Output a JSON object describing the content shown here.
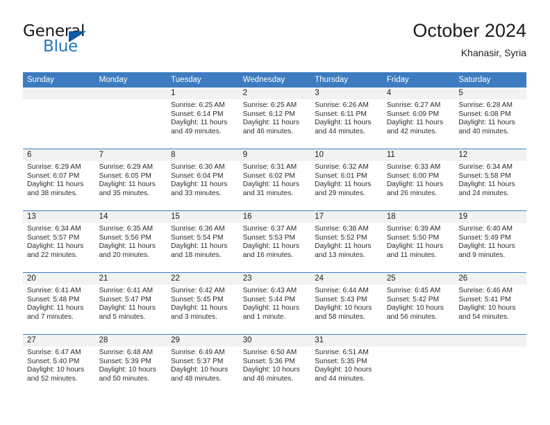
{
  "logo": {
    "word1": "General",
    "word2": "Blue",
    "triangle_color": "#0a5aa8",
    "blue_color": "#2176bd"
  },
  "header": {
    "title": "October 2024",
    "subtitle": "Khanasir, Syria"
  },
  "theme": {
    "header_blue": "#3d7cc0",
    "daynum_bg": "#f2f2f2",
    "text": "#2b2b2b"
  },
  "weekdays": [
    "Sunday",
    "Monday",
    "Tuesday",
    "Wednesday",
    "Thursday",
    "Friday",
    "Saturday"
  ],
  "weeks": [
    [
      {
        "day": "",
        "empty": true
      },
      {
        "day": "",
        "empty": true
      },
      {
        "day": "1",
        "sunrise": "Sunrise: 6:25 AM",
        "sunset": "Sunset: 6:14 PM",
        "daylight": "Daylight: 11 hours and 49 minutes."
      },
      {
        "day": "2",
        "sunrise": "Sunrise: 6:25 AM",
        "sunset": "Sunset: 6:12 PM",
        "daylight": "Daylight: 11 hours and 46 minutes."
      },
      {
        "day": "3",
        "sunrise": "Sunrise: 6:26 AM",
        "sunset": "Sunset: 6:11 PM",
        "daylight": "Daylight: 11 hours and 44 minutes."
      },
      {
        "day": "4",
        "sunrise": "Sunrise: 6:27 AM",
        "sunset": "Sunset: 6:09 PM",
        "daylight": "Daylight: 11 hours and 42 minutes."
      },
      {
        "day": "5",
        "sunrise": "Sunrise: 6:28 AM",
        "sunset": "Sunset: 6:08 PM",
        "daylight": "Daylight: 11 hours and 40 minutes."
      }
    ],
    [
      {
        "day": "6",
        "sunrise": "Sunrise: 6:29 AM",
        "sunset": "Sunset: 6:07 PM",
        "daylight": "Daylight: 11 hours and 38 minutes."
      },
      {
        "day": "7",
        "sunrise": "Sunrise: 6:29 AM",
        "sunset": "Sunset: 6:05 PM",
        "daylight": "Daylight: 11 hours and 35 minutes."
      },
      {
        "day": "8",
        "sunrise": "Sunrise: 6:30 AM",
        "sunset": "Sunset: 6:04 PM",
        "daylight": "Daylight: 11 hours and 33 minutes."
      },
      {
        "day": "9",
        "sunrise": "Sunrise: 6:31 AM",
        "sunset": "Sunset: 6:02 PM",
        "daylight": "Daylight: 11 hours and 31 minutes."
      },
      {
        "day": "10",
        "sunrise": "Sunrise: 6:32 AM",
        "sunset": "Sunset: 6:01 PM",
        "daylight": "Daylight: 11 hours and 29 minutes."
      },
      {
        "day": "11",
        "sunrise": "Sunrise: 6:33 AM",
        "sunset": "Sunset: 6:00 PM",
        "daylight": "Daylight: 11 hours and 26 minutes."
      },
      {
        "day": "12",
        "sunrise": "Sunrise: 6:34 AM",
        "sunset": "Sunset: 5:58 PM",
        "daylight": "Daylight: 11 hours and 24 minutes."
      }
    ],
    [
      {
        "day": "13",
        "sunrise": "Sunrise: 6:34 AM",
        "sunset": "Sunset: 5:57 PM",
        "daylight": "Daylight: 11 hours and 22 minutes."
      },
      {
        "day": "14",
        "sunrise": "Sunrise: 6:35 AM",
        "sunset": "Sunset: 5:56 PM",
        "daylight": "Daylight: 11 hours and 20 minutes."
      },
      {
        "day": "15",
        "sunrise": "Sunrise: 6:36 AM",
        "sunset": "Sunset: 5:54 PM",
        "daylight": "Daylight: 11 hours and 18 minutes."
      },
      {
        "day": "16",
        "sunrise": "Sunrise: 6:37 AM",
        "sunset": "Sunset: 5:53 PM",
        "daylight": "Daylight: 11 hours and 16 minutes."
      },
      {
        "day": "17",
        "sunrise": "Sunrise: 6:38 AM",
        "sunset": "Sunset: 5:52 PM",
        "daylight": "Daylight: 11 hours and 13 minutes."
      },
      {
        "day": "18",
        "sunrise": "Sunrise: 6:39 AM",
        "sunset": "Sunset: 5:50 PM",
        "daylight": "Daylight: 11 hours and 11 minutes."
      },
      {
        "day": "19",
        "sunrise": "Sunrise: 6:40 AM",
        "sunset": "Sunset: 5:49 PM",
        "daylight": "Daylight: 11 hours and 9 minutes."
      }
    ],
    [
      {
        "day": "20",
        "sunrise": "Sunrise: 6:41 AM",
        "sunset": "Sunset: 5:48 PM",
        "daylight": "Daylight: 11 hours and 7 minutes."
      },
      {
        "day": "21",
        "sunrise": "Sunrise: 6:41 AM",
        "sunset": "Sunset: 5:47 PM",
        "daylight": "Daylight: 11 hours and 5 minutes."
      },
      {
        "day": "22",
        "sunrise": "Sunrise: 6:42 AM",
        "sunset": "Sunset: 5:45 PM",
        "daylight": "Daylight: 11 hours and 3 minutes."
      },
      {
        "day": "23",
        "sunrise": "Sunrise: 6:43 AM",
        "sunset": "Sunset: 5:44 PM",
        "daylight": "Daylight: 11 hours and 1 minute."
      },
      {
        "day": "24",
        "sunrise": "Sunrise: 6:44 AM",
        "sunset": "Sunset: 5:43 PM",
        "daylight": "Daylight: 10 hours and 58 minutes."
      },
      {
        "day": "25",
        "sunrise": "Sunrise: 6:45 AM",
        "sunset": "Sunset: 5:42 PM",
        "daylight": "Daylight: 10 hours and 56 minutes."
      },
      {
        "day": "26",
        "sunrise": "Sunrise: 6:46 AM",
        "sunset": "Sunset: 5:41 PM",
        "daylight": "Daylight: 10 hours and 54 minutes."
      }
    ],
    [
      {
        "day": "27",
        "sunrise": "Sunrise: 6:47 AM",
        "sunset": "Sunset: 5:40 PM",
        "daylight": "Daylight: 10 hours and 52 minutes."
      },
      {
        "day": "28",
        "sunrise": "Sunrise: 6:48 AM",
        "sunset": "Sunset: 5:39 PM",
        "daylight": "Daylight: 10 hours and 50 minutes."
      },
      {
        "day": "29",
        "sunrise": "Sunrise: 6:49 AM",
        "sunset": "Sunset: 5:37 PM",
        "daylight": "Daylight: 10 hours and 48 minutes."
      },
      {
        "day": "30",
        "sunrise": "Sunrise: 6:50 AM",
        "sunset": "Sunset: 5:36 PM",
        "daylight": "Daylight: 10 hours and 46 minutes."
      },
      {
        "day": "31",
        "sunrise": "Sunrise: 6:51 AM",
        "sunset": "Sunset: 5:35 PM",
        "daylight": "Daylight: 10 hours and 44 minutes."
      },
      {
        "day": "",
        "empty": true
      },
      {
        "day": "",
        "empty": true
      }
    ]
  ]
}
